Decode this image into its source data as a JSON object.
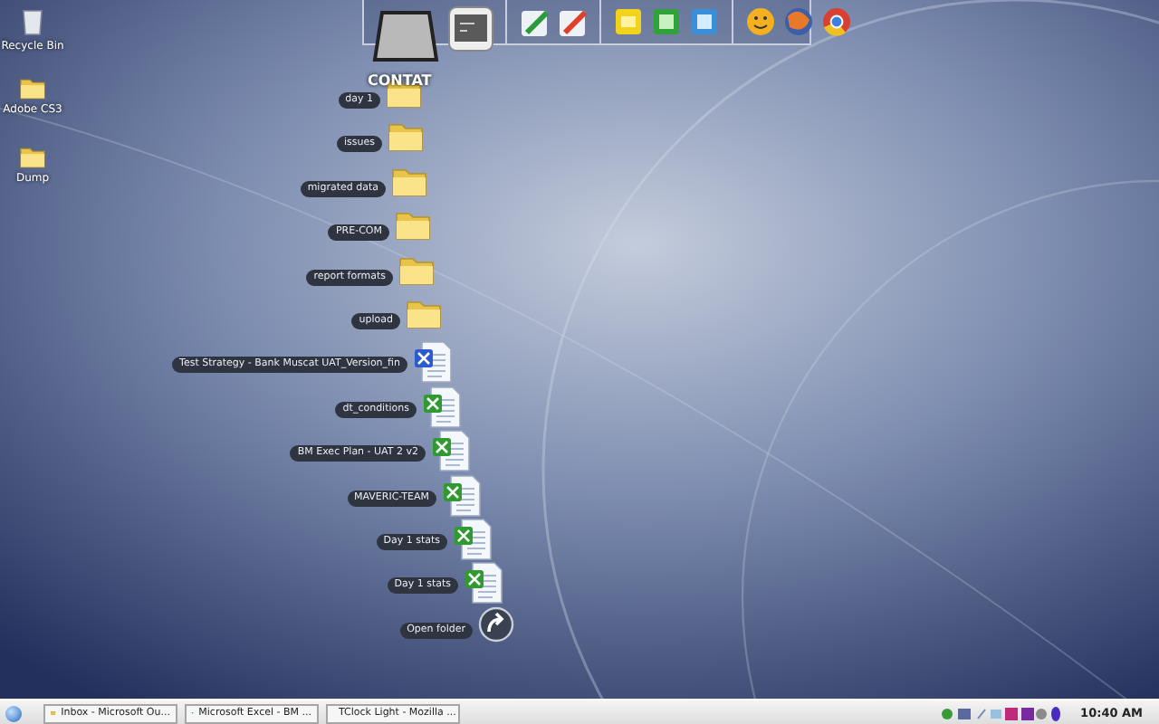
{
  "desktop_icons": [
    {
      "label": "Recycle Bin",
      "kind": "bin"
    },
    {
      "label": "Adobe CS3",
      "kind": "folder"
    },
    {
      "label": "Dump",
      "kind": "folder"
    }
  ],
  "dock": {
    "drive_label": "CONTAT",
    "groups": [
      [
        {
          "kind": "drive"
        },
        {
          "kind": "terminal"
        }
      ],
      [
        {
          "kind": "pen-green"
        },
        {
          "kind": "pen-red"
        }
      ],
      [
        {
          "kind": "yellow"
        },
        {
          "kind": "green"
        },
        {
          "kind": "blue"
        }
      ],
      [
        {
          "kind": "smiley"
        },
        {
          "kind": "globe"
        },
        {
          "kind": "chrome"
        }
      ]
    ]
  },
  "stack": [
    {
      "label": "day 1",
      "kind": "folder"
    },
    {
      "label": "issues",
      "kind": "folder"
    },
    {
      "label": "migrated data",
      "kind": "folder"
    },
    {
      "label": "PRE-COM",
      "kind": "folder"
    },
    {
      "label": "report formats",
      "kind": "folder"
    },
    {
      "label": "upload",
      "kind": "folder"
    },
    {
      "label": "Test Strategy - Bank Muscat UAT_Version_fin",
      "kind": "word"
    },
    {
      "label": "dt_conditions",
      "kind": "excel"
    },
    {
      "label": "BM Exec Plan - UAT 2 v2",
      "kind": "excel"
    },
    {
      "label": "MAVERIC-TEAM",
      "kind": "excel"
    },
    {
      "label": "Day 1 stats",
      "kind": "excel"
    },
    {
      "label": "Day 1 stats",
      "kind": "excel"
    },
    {
      "label": "Open folder",
      "kind": "action"
    }
  ],
  "taskbar": {
    "buttons": [
      {
        "label": "Inbox - Microsoft Ou...",
        "kind": "mail"
      },
      {
        "label": "Microsoft Excel - BM ...",
        "kind": "excel"
      },
      {
        "label": "TClock Light - Mozilla ...",
        "kind": "browser"
      }
    ],
    "clock": "10:40 AM"
  }
}
